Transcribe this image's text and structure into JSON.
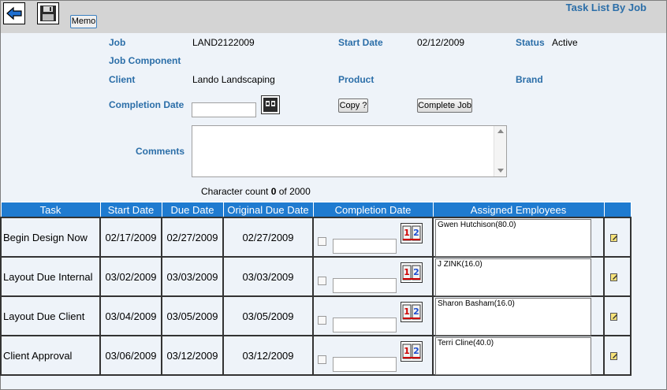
{
  "toolbar": {
    "back_icon": "back-arrow-icon",
    "save_icon": "save-disk-icon",
    "memo_label": "Memo"
  },
  "page_title": "Task List By Job",
  "job": {
    "job_label": "Job",
    "job_value": "LAND2122009",
    "start_date_label": "Start Date",
    "start_date_value": "02/12/2009",
    "status_label": "Status",
    "status_value": "Active",
    "job_component_label": "Job Component",
    "client_label": "Client",
    "client_value": "Lando Landscaping",
    "product_label": "Product",
    "brand_label": "Brand",
    "completion_date_label": "Completion Date",
    "completion_date_value": "",
    "copy_label": "Copy ?",
    "complete_job_label": "Complete Job",
    "comments_label": "Comments",
    "comments_value": "",
    "char_count_prefix": "Character count ",
    "char_count_value": "0",
    "char_count_suffix": " of 2000"
  },
  "table": {
    "headers": [
      "Task",
      "Start Date",
      "Due Date",
      "Original Due Date",
      "Completion Date",
      "Assigned Employees",
      ""
    ],
    "rows": [
      {
        "task": "Begin Design Now",
        "start": "02/17/2009",
        "due": "02/27/2009",
        "orig_due": "02/27/2009",
        "completion": "",
        "employees": "Gwen Hutchison(80.0)"
      },
      {
        "task": "Layout Due Internal",
        "start": "03/02/2009",
        "due": "03/03/2009",
        "orig_due": "03/03/2009",
        "completion": "",
        "employees": "J ZINK(16.0)"
      },
      {
        "task": "Layout Due Client",
        "start": "03/04/2009",
        "due": "03/05/2009",
        "orig_due": "03/05/2009",
        "completion": "",
        "employees": "Sharon Basham(16.0)"
      },
      {
        "task": "Client Approval",
        "start": "03/06/2009",
        "due": "03/12/2009",
        "orig_due": "03/12/2009",
        "completion": "",
        "employees": "Terri Cline(40.0)"
      }
    ]
  },
  "colors": {
    "label_blue": "#2b6ea8",
    "header_blue": "#1f7bd0",
    "background": "#eef3f9",
    "topbar": "#d4d4d4"
  }
}
